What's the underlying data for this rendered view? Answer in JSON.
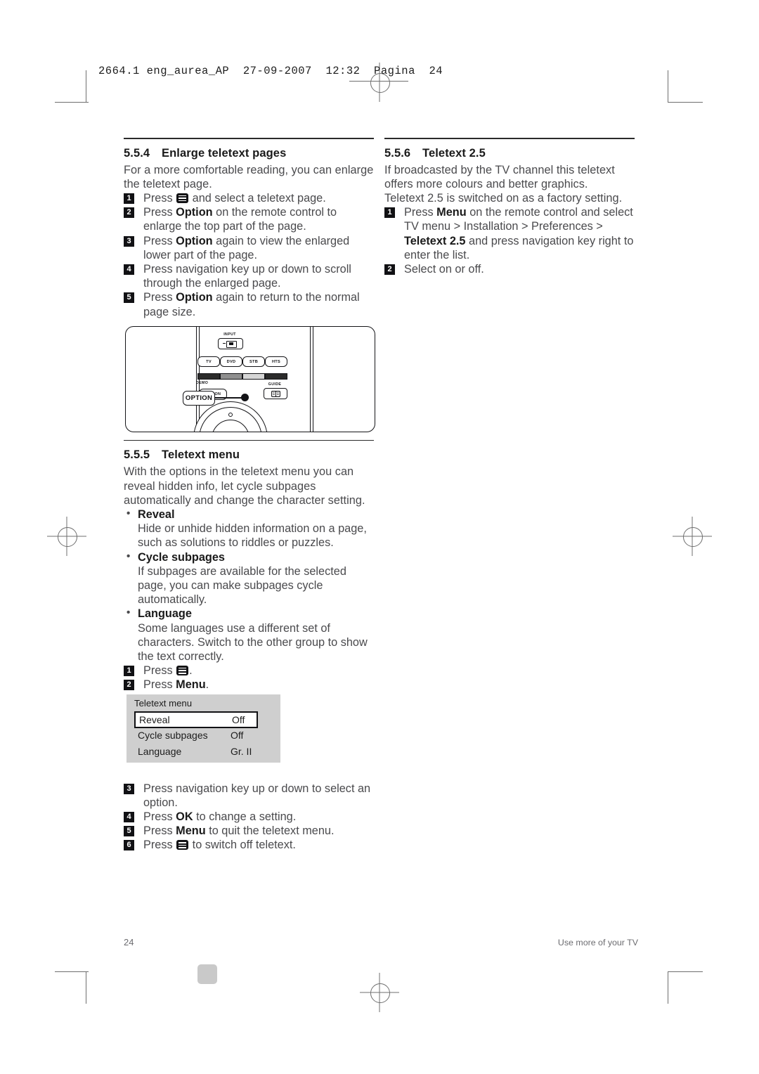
{
  "print_slug": {
    "text": "2664.1 eng_aurea_AP  27-09-2007  12:32  Pagina  24"
  },
  "left_column": {
    "section_554": {
      "number": "5.5.4",
      "title": "Enlarge teletext pages",
      "intro": "For a more comfortable reading, you can enlarge the teletext page.",
      "steps": [
        {
          "num": "1",
          "pre": "Press ",
          "icon": "teletext-icon",
          "post": " and select a teletext page."
        },
        {
          "num": "2",
          "pre": "Press ",
          "kw": "Option",
          "post": " on the remote control to enlarge the top part of the page."
        },
        {
          "num": "3",
          "pre": "Press ",
          "kw": "Option",
          "post": " again to view the enlarged lower part of the page."
        },
        {
          "num": "4",
          "pre": "Press navigation key up or down to scroll through the enlarged page.",
          "kw": "",
          "post": ""
        },
        {
          "num": "5",
          "pre": "Press ",
          "kw": "Option",
          "post": " again to return to the normal page size."
        }
      ]
    },
    "section_555": {
      "number": "5.5.5",
      "title": "Teletext menu",
      "intro": "With the options in the teletext menu you can reveal hidden info, let cycle subpages automatically and change the character setting.",
      "bullets": [
        {
          "label": "Reveal",
          "desc": "Hide or unhide hidden information on a page, such as solutions to riddles or puzzles."
        },
        {
          "label": "Cycle subpages",
          "desc": "If subpages are available for the selected page, you can make subpages cycle automatically."
        },
        {
          "label": "Language",
          "desc": "Some languages use a different set of characters. Switch to the other group to show the text correctly."
        }
      ],
      "steps_top": [
        {
          "num": "1",
          "pre": "Press ",
          "icon": "teletext-icon",
          "post": "."
        },
        {
          "num": "2",
          "pre": "Press ",
          "kw": "Menu",
          "post": "."
        }
      ],
      "steps_bottom": [
        {
          "num": "3",
          "pre": "Press navigation key up or down to select an option.",
          "kw": "",
          "post": ""
        },
        {
          "num": "4",
          "pre": "Press ",
          "kw": "OK",
          "post": " to change a setting."
        },
        {
          "num": "5",
          "pre": "Press ",
          "kw": "Menu",
          "post": " to quit the teletext menu."
        },
        {
          "num": "6",
          "pre": "Press ",
          "icon": "teletext-icon",
          "post": " to switch off teletext."
        }
      ]
    }
  },
  "right_column": {
    "section_556": {
      "number": "5.5.6",
      "title": "Teletext 2.5",
      "intro1": "If broadcasted by the TV channel this teletext offers more colours and better graphics.",
      "intro2": "Teletext 2.5 is switched on as a factory setting.",
      "step1_a": "Press ",
      "step1_kw": "Menu",
      "step1_b": " on the remote control and select",
      "step1_path": "TV menu >  Installation > Preferences >",
      "step1_kw2": "Teletext 2.5",
      "step1_c": " and press navigation key right to enter the list.",
      "step1_num": "1",
      "step2_num": "2",
      "step2_text": "Select on or off."
    }
  },
  "remote_illustration": {
    "input_label": "INPUT",
    "source_buttons": [
      "TV",
      "DVD",
      "STB",
      "HTS"
    ],
    "demo_label": "DEMO",
    "option_label": "OPTION",
    "guide_label": "GUIDE",
    "color_bars": [
      "#2b2b2b",
      "#8f8f8f",
      "#d6d6d6",
      "#2b2b2b"
    ],
    "callout_label": "OPTION"
  },
  "osd": {
    "title": "Teletext menu",
    "rows": [
      {
        "label": "Reveal",
        "value": "Off",
        "selected": true
      },
      {
        "label": "Cycle subpages",
        "value": "Off",
        "selected": false
      },
      {
        "label": "Language",
        "value": "Gr. II",
        "selected": false
      }
    ],
    "bg_color": "#cfcfcf",
    "selected_bg": "#ffffff"
  },
  "footer": {
    "page_number": "24",
    "running_head": "Use more of your TV"
  }
}
